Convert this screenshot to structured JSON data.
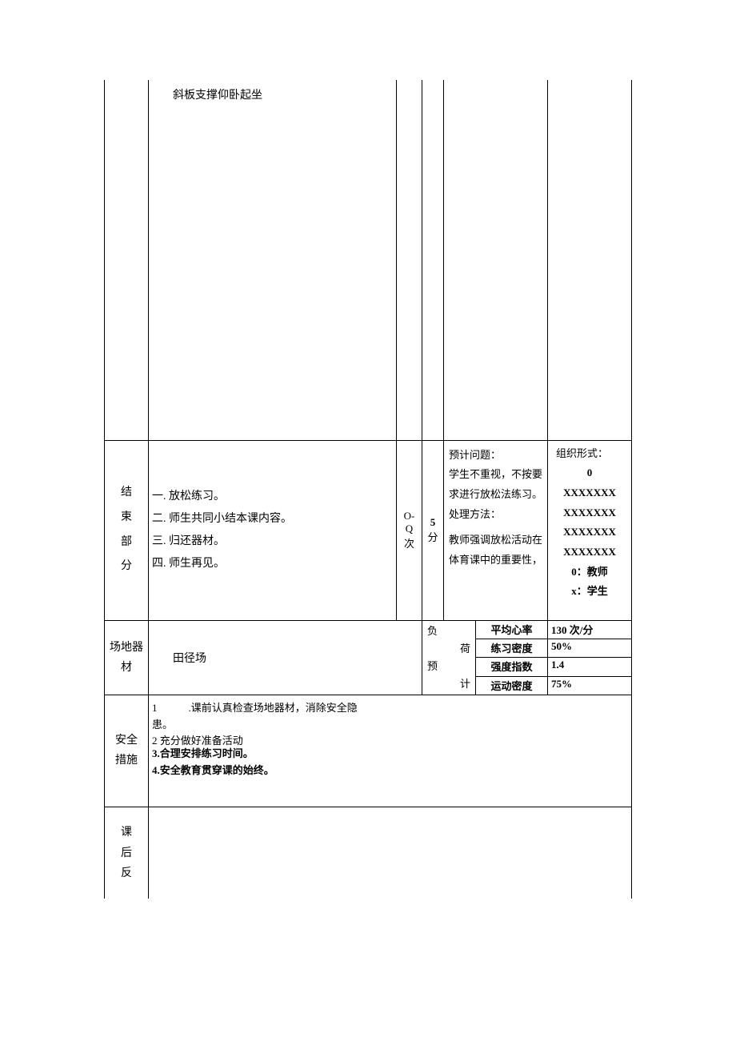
{
  "row1": {
    "content": "斜板支撑仰卧起坐"
  },
  "conclusion": {
    "section_label": "结\n束\n部\n分",
    "items": {
      "a": "一. 放松练习。",
      "b": "二. 师生共同小结本课内容。",
      "c": "三. 归还器材。",
      "d": "四. 师生再见。"
    },
    "reps": "O-Q\n次",
    "time": "5\n分",
    "problem": {
      "title": "预计问题：",
      "body": "学生不重视，不按要求进行放松法练习。",
      "method_title": "处理方法：",
      "method_body": "教师强调放松活动在体育课中的重要性，"
    },
    "org": {
      "title": "组织形式：",
      "teacher_sym": "0",
      "row_x": "XXXXXXX",
      "legend_teacher": "0：教师",
      "legend_student": "x：学生"
    }
  },
  "venue": {
    "label": "场地器\n材",
    "value": "田径场",
    "load_label_1": "负",
    "load_label_2": "荷",
    "load_label_3": "预",
    "load_label_4": "计",
    "metrics": {
      "avg_hr_label": "平均心率",
      "avg_hr_val": "130 次/分",
      "density_label": "练习密度",
      "density_val": "50%",
      "intensity_label": "强度指数",
      "intensity_val": "1.4",
      "motion_label": "运动密度",
      "motion_val": "75%"
    }
  },
  "safety": {
    "label": "安全\n措施",
    "items": {
      "a": "1　　　.课前认真检查场地器材，消除安全隐患。",
      "b": "2 充分做好准备活动",
      "c": "3.合理安排练习时间。",
      "d": "4.安全教育贯穿课的始终。"
    }
  },
  "reflection": {
    "label": "课\n后\n反"
  }
}
